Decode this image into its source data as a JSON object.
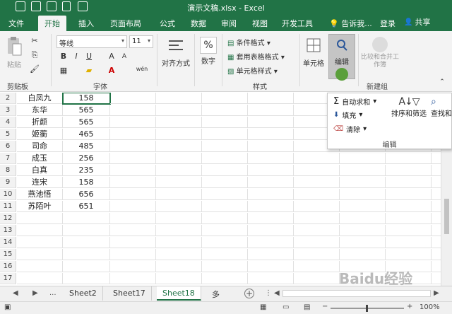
{
  "window": {
    "title": "演示文稿.xlsx - Excel"
  },
  "tabs": [
    "文件",
    "开始",
    "插入",
    "页面布局",
    "公式",
    "数据",
    "审阅",
    "视图",
    "开发工具"
  ],
  "active_tab": "开始",
  "tell_me": "告诉我...",
  "login": "登录",
  "share": "共享",
  "ribbon": {
    "paste": "粘贴",
    "clipboard_group": "剪贴板",
    "font_name": "等线",
    "font_size": "11",
    "font_group": "字体",
    "align": "对齐方式",
    "number": "数字",
    "cond_format": "条件格式",
    "table_format": "套用表格格式",
    "cell_style": "单元格样式",
    "style_group": "样式",
    "cells": "单元格",
    "edit": "编辑",
    "compare_merge": "比较和合并工作簿",
    "new_group": "新建组",
    "percent_symbol": "%",
    "wen_label": "wén",
    "font_a_label": "A"
  },
  "edit_panel": {
    "autosum": "自动求和",
    "fill": "填充",
    "clear": "清除",
    "sort_filter": "排序和筛选",
    "find_select": "查找和",
    "group_label": "编辑"
  },
  "rows": [
    {
      "num": "2",
      "name": "白凤九",
      "value": "158"
    },
    {
      "num": "3",
      "name": "东华",
      "value": "565"
    },
    {
      "num": "4",
      "name": "折颜",
      "value": "565"
    },
    {
      "num": "5",
      "name": "姬蘅",
      "value": "465"
    },
    {
      "num": "6",
      "name": "司命",
      "value": "485"
    },
    {
      "num": "7",
      "name": "成玉",
      "value": "256"
    },
    {
      "num": "8",
      "name": "白真",
      "value": "235"
    },
    {
      "num": "9",
      "name": "连宋",
      "value": "158"
    },
    {
      "num": "10",
      "name": "燕池悟",
      "value": "656"
    },
    {
      "num": "11",
      "name": "苏陌叶",
      "value": "651"
    },
    {
      "num": "12",
      "name": "",
      "value": ""
    },
    {
      "num": "13",
      "name": "",
      "value": ""
    },
    {
      "num": "14",
      "name": "",
      "value": ""
    },
    {
      "num": "15",
      "name": "",
      "value": ""
    },
    {
      "num": "16",
      "name": "",
      "value": ""
    },
    {
      "num": "17",
      "name": "",
      "value": ""
    }
  ],
  "sheets": [
    "Sheet2",
    "Sheet17",
    "Sheet18",
    "多"
  ],
  "active_sheet": "Sheet18",
  "sheet_nav": {
    "prev": "◀",
    "next": "▶",
    "more": "...",
    "add": "+"
  },
  "status": {
    "zoom": "100%",
    "minus": "−",
    "plus": "+"
  },
  "watermark": "Baidu经验",
  "colors": {
    "excel_green": "#217346",
    "accent_dark": "#1e6b41"
  }
}
